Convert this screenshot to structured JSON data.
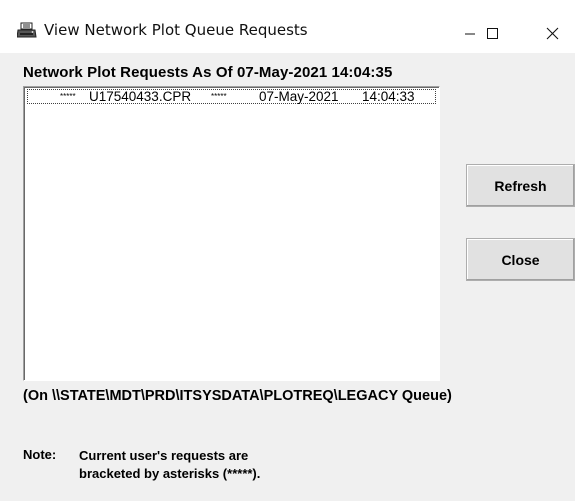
{
  "window": {
    "title": "View Network Plot Queue Requests",
    "controls": {
      "minimize": "—",
      "maximize": "☐",
      "close": "✕"
    }
  },
  "heading": "Network Plot Requests As Of 07-May-2021 14:04:35",
  "list": {
    "items": [
      {
        "stars_before": "*****",
        "filename": "U17540433.CPR",
        "stars_after": "*****",
        "date": "07-May-2021",
        "time": "14:04:33"
      }
    ]
  },
  "buttons": {
    "refresh": "Refresh",
    "close": "Close"
  },
  "queue_path": "(On \\\\STATE\\MDT\\PRD\\ITSYSDATA\\PLOTREQ\\LEGACY Queue)",
  "note": {
    "label": "Note:",
    "line1": "Current user's requests are",
    "line2": "bracketed by asterisks (*****)."
  },
  "icons": {
    "app": "printer-icon",
    "minimize": "minimize-icon",
    "maximize": "maximize-icon",
    "close": "close-icon"
  }
}
